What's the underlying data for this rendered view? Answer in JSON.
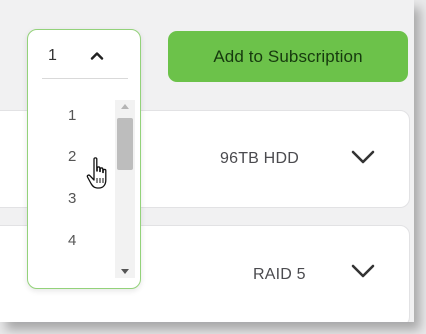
{
  "header": {
    "quantity_value": "1",
    "add_button_label": "Add to Subscription"
  },
  "quantity_select": {
    "options": [
      "1",
      "2",
      "3",
      "4"
    ],
    "hovered_option": "2"
  },
  "items": [
    {
      "value": "96TB HDD"
    },
    {
      "value": "RAID 5"
    }
  ],
  "colors": {
    "accent": "#6cc24a",
    "select_border": "#93d27a"
  },
  "icons": {
    "caret": "chevron-up-icon",
    "expand": "chevron-down-icon",
    "cursor": "hand-pointer-icon"
  }
}
